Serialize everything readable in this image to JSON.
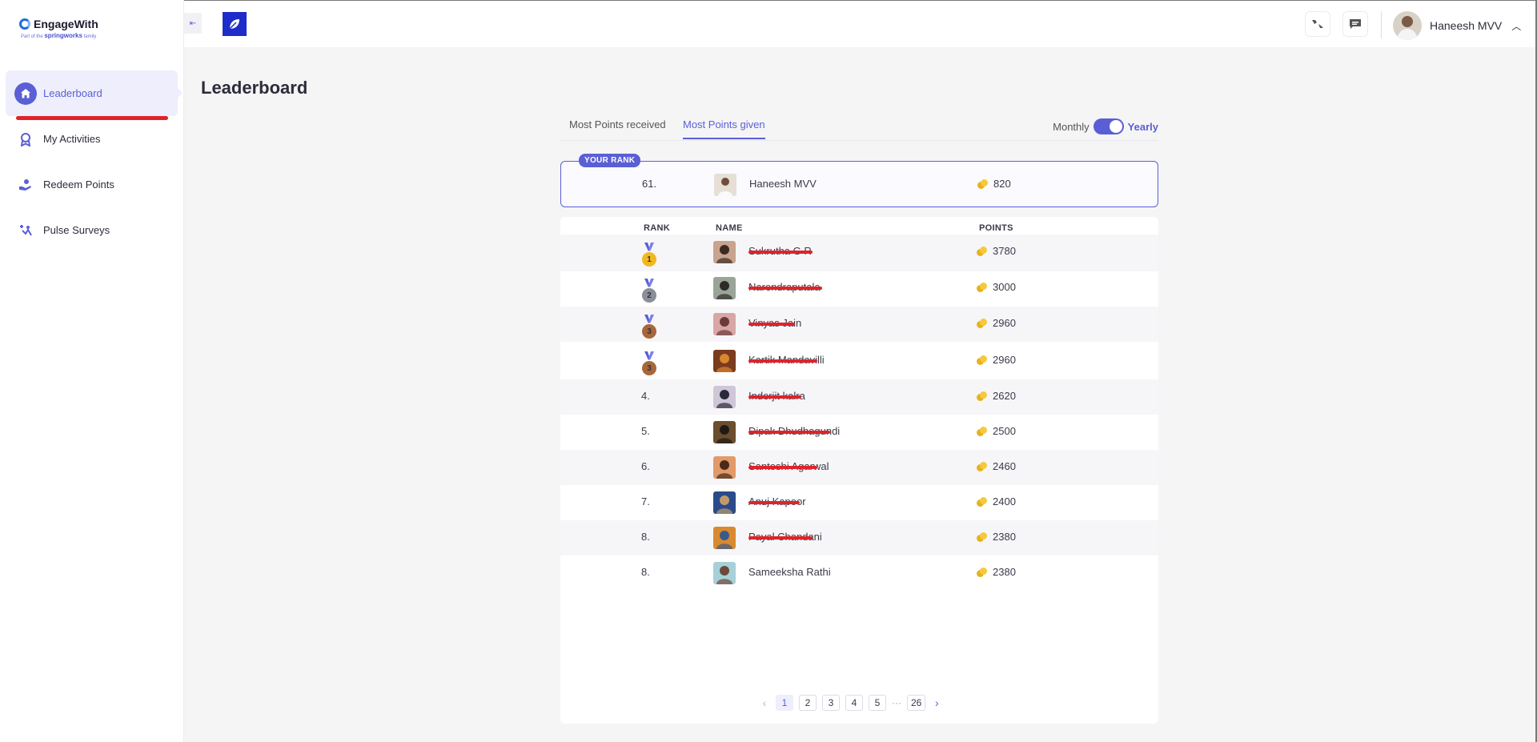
{
  "brand": {
    "name": "EngageWith",
    "tagline_prefix": "Part of the",
    "tagline_brand": "springworks",
    "tagline_suffix": "family"
  },
  "sidebar": {
    "items": [
      {
        "label": "Leaderboard",
        "icon": "home-icon",
        "active": true
      },
      {
        "label": "My Activities",
        "icon": "award-icon",
        "active": false
      },
      {
        "label": "Redeem Points",
        "icon": "hand-coin-icon",
        "active": false
      },
      {
        "label": "Pulse Surveys",
        "icon": "pulse-survey-icon",
        "active": false
      }
    ]
  },
  "topbar": {
    "user_name": "Haneesh MVV",
    "collapse_icon": "collapse-left-icon",
    "feedback_icon": "thumbs-icon",
    "chat_icon": "chat-icon",
    "app_icon": "leaf-icon"
  },
  "page": {
    "title": "Leaderboard"
  },
  "tabs": {
    "received": "Most Points received",
    "given": "Most Points given",
    "active": "given"
  },
  "period_toggle": {
    "left": "Monthly",
    "right": "Yearly",
    "selected": "Yearly"
  },
  "your_rank": {
    "badge": "YOUR RANK",
    "rank": "61.",
    "name": "Haneesh MVV",
    "points": "820"
  },
  "table": {
    "headers": {
      "rank": "RANK",
      "name": "NAME",
      "points": "POINTS"
    },
    "rows": [
      {
        "rank": "1",
        "medal": "gold",
        "name": "Sukrutha G R",
        "points": "3780",
        "redacted": true
      },
      {
        "rank": "2",
        "medal": "silver",
        "name": "Narendraputala",
        "points": "3000",
        "redacted": true
      },
      {
        "rank": "3",
        "medal": "bronze",
        "name": "Vinyas Jain",
        "points": "2960",
        "redacted": true
      },
      {
        "rank": "3",
        "medal": "bronze",
        "name": "Kartik Mandavilli",
        "points": "2960",
        "redacted": true
      },
      {
        "rank": "4.",
        "medal": "",
        "name": "Inderjit kalra",
        "points": "2620",
        "redacted": true
      },
      {
        "rank": "5.",
        "medal": "",
        "name": "Dipak Dhudhagundi",
        "points": "2500",
        "redacted": true
      },
      {
        "rank": "6.",
        "medal": "",
        "name": "Santoshi Agarwal",
        "points": "2460",
        "redacted": true
      },
      {
        "rank": "7.",
        "medal": "",
        "name": "Anuj Kapoor",
        "points": "2400",
        "redacted": true
      },
      {
        "rank": "8.",
        "medal": "",
        "name": "Payal Chandani",
        "points": "2380",
        "redacted": true
      },
      {
        "rank": "8.",
        "medal": "",
        "name": "Sameeksha Rathi",
        "points": "2380",
        "redacted": false
      }
    ]
  },
  "pagination": {
    "pages": [
      "1",
      "2",
      "3",
      "4",
      "5"
    ],
    "ellipsis": "···",
    "last": "26",
    "current": "1"
  },
  "colors": {
    "accent": "#5a5fd6",
    "redact": "#e0232a",
    "gold": "#f2b81f",
    "silver": "#8a8f9a",
    "bronze": "#a8673a"
  }
}
